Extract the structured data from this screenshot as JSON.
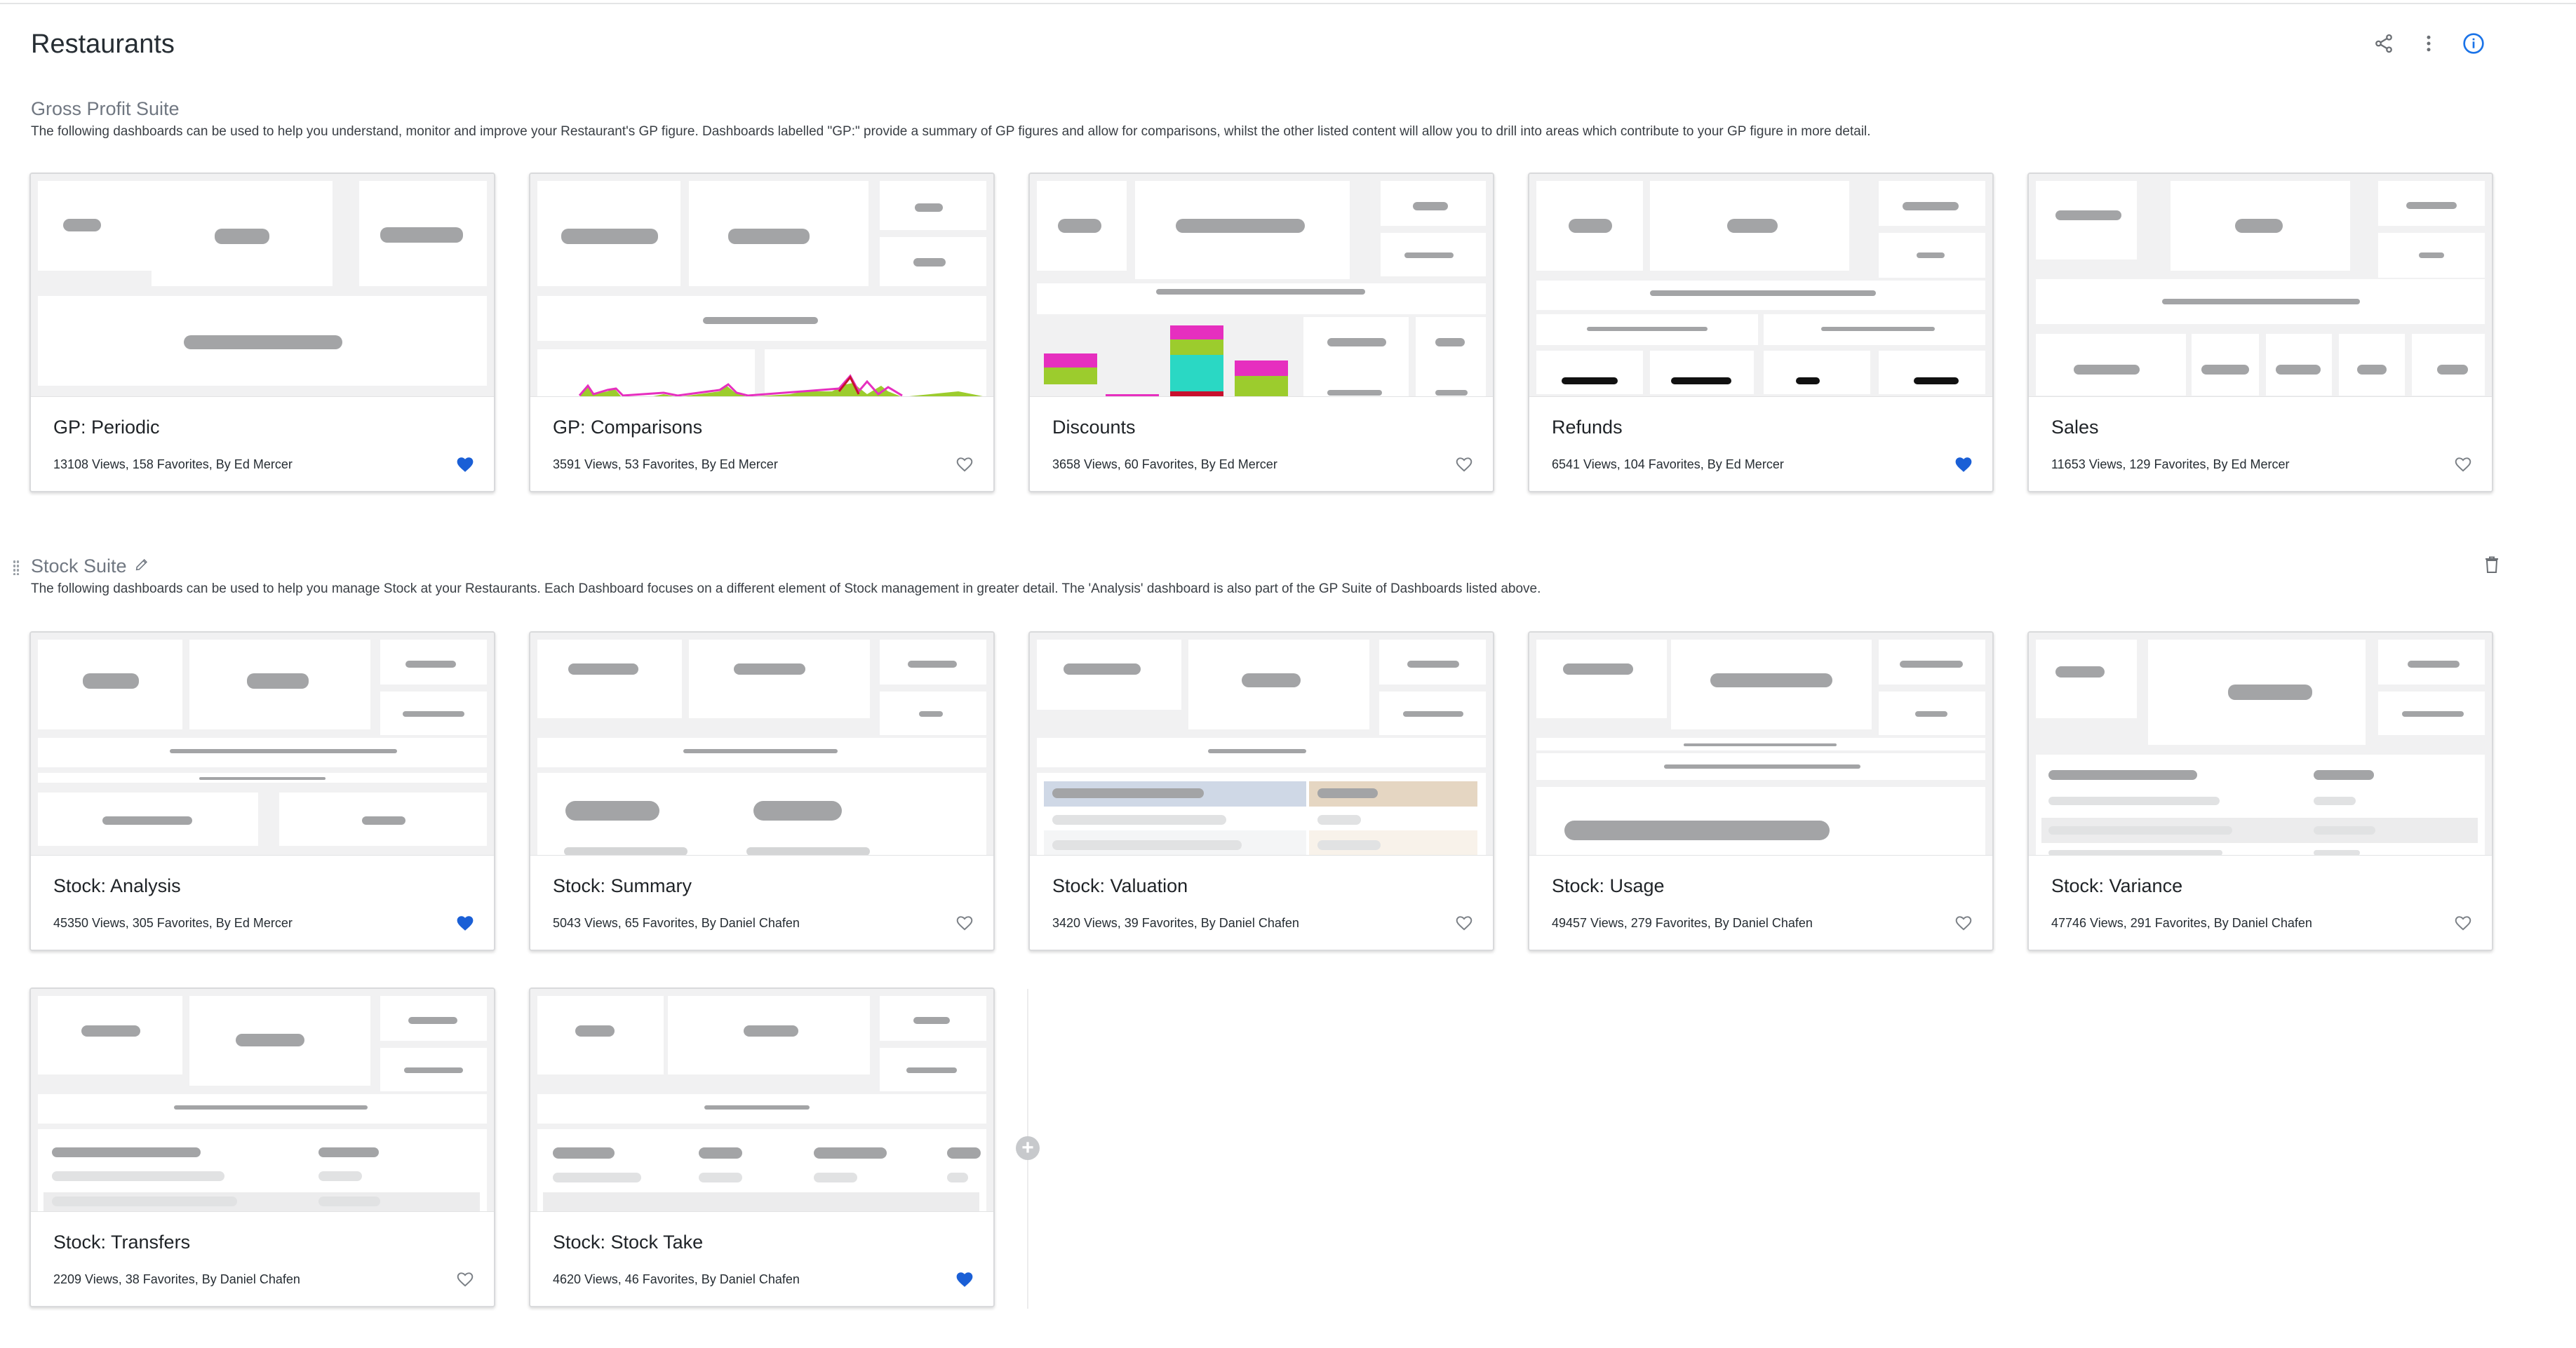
{
  "page": {
    "title": "Restaurants"
  },
  "header": {
    "icons": [
      "share-icon",
      "more-vert-icon",
      "info-icon"
    ]
  },
  "sections": [
    {
      "title": "Gross Profit Suite",
      "description": "The following dashboards can be used to help you understand, monitor and improve your Restaurant's GP figure. Dashboards labelled \"GP:\" provide a summary of GP figures and allow for comparisons, whilst the other listed content will allow you to drill into areas which contribute to your GP figure in more detail.",
      "cards": [
        {
          "title": "GP: Periodic",
          "meta": "13108 Views, 158 Favorites, By Ed Mercer",
          "favorited": true
        },
        {
          "title": "GP: Comparisons",
          "meta": "3591 Views, 53 Favorites, By Ed Mercer",
          "favorited": false
        },
        {
          "title": "Discounts",
          "meta": "3658 Views, 60 Favorites, By Ed Mercer",
          "favorited": false
        },
        {
          "title": "Refunds",
          "meta": "6541 Views, 104 Favorites, By Ed Mercer",
          "favorited": true
        },
        {
          "title": "Sales",
          "meta": "11653 Views, 129 Favorites, By Ed Mercer",
          "favorited": false
        }
      ]
    },
    {
      "title": "Stock Suite",
      "description": "The following dashboards can be used to help you manage Stock at your Restaurants. Each Dashboard focuses on a different element of Stock management in greater detail. The 'Analysis' dashboard is also part of the GP Suite of Dashboards listed above.",
      "cards": [
        {
          "title": "Stock: Analysis",
          "meta": "45350 Views, 305 Favorites, By Ed Mercer",
          "favorited": true
        },
        {
          "title": "Stock: Summary",
          "meta": "5043 Views, 65 Favorites, By Daniel Chafen",
          "favorited": false
        },
        {
          "title": "Stock: Valuation",
          "meta": "3420 Views, 39 Favorites, By Daniel Chafen",
          "favorited": false
        },
        {
          "title": "Stock: Usage",
          "meta": "49457 Views, 279 Favorites, By Daniel Chafen",
          "favorited": false
        },
        {
          "title": "Stock: Variance",
          "meta": "47746 Views, 291 Favorites, By Daniel Chafen",
          "favorited": false
        },
        {
          "title": "Stock: Transfers",
          "meta": "2209 Views, 38 Favorites, By Daniel Chafen",
          "favorited": false
        },
        {
          "title": "Stock: Stock Take",
          "meta": "4620 Views, 46 Favorites, By Daniel Chafen",
          "favorited": true
        }
      ]
    }
  ],
  "colors": {
    "accent": "#1a73e8",
    "favorite": "#1a5fd6",
    "magenta": "#e62fbf",
    "green": "#9ccc2d",
    "teal": "#2ad8c4",
    "red": "#c8102e"
  }
}
